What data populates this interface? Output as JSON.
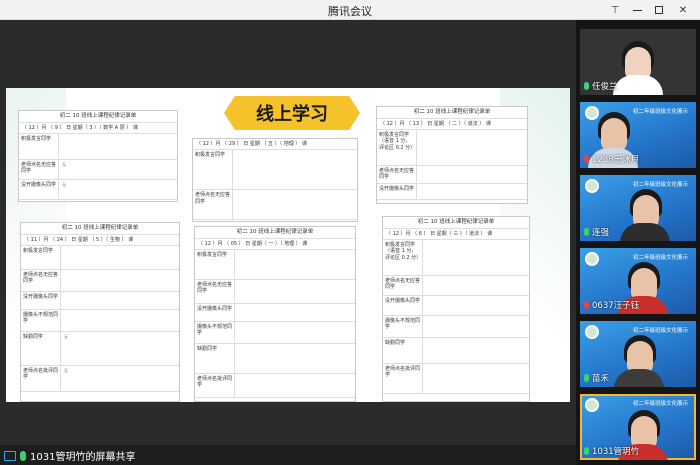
{
  "window": {
    "title": "腾讯会议"
  },
  "banner": "线上学习",
  "forms": [
    {
      "title": "初二 10 班线上课程纪律记录单",
      "head": "（ 12 ）月 （ 9 ） 日 星期（ 3 ）（ 数学 A 层 ） 课",
      "rows": [
        {
          "label": "积极发言同学",
          "value": ""
        },
        {
          "label": "老师点名无应答同学",
          "value": "无"
        },
        {
          "label": "没开摄像头同学",
          "value": "无"
        }
      ]
    },
    {
      "title": "初二 10 班线上课程纪律记录单",
      "head": "（ 11 ）月 （ 24 ） 日 星期 （ 5 ）（ 生物 ） 课",
      "rows": [
        {
          "label": "积极发言同学",
          "value": ""
        },
        {
          "label": "老师点名无应答同学",
          "value": ""
        },
        {
          "label": "没开摄像头同学",
          "value": ""
        },
        {
          "label": "摄像头不规范同学",
          "value": ""
        },
        {
          "label": "缺勤同学",
          "value": "无"
        },
        {
          "label": "老师点名批评同学",
          "value": "无"
        }
      ]
    },
    {
      "title": "",
      "head": "（ 12 ）月 （ 29 ） 日 星期 （ 五 ）（ 地理 ） 课",
      "rows": [
        {
          "label": "积极发言同学",
          "value": ""
        },
        {
          "label": "老师点名无应答同学",
          "value": ""
        }
      ]
    },
    {
      "title": "初二 10 班线上课程纪律记录单",
      "head": "（ 12 ）月 （ 05 ） 日 星期（ 一 ）（ 地理 ） 课",
      "rows": [
        {
          "label": "积极发言同学",
          "value": ""
        },
        {
          "label": "老师点名无应答同学",
          "value": ""
        },
        {
          "label": "没开摄像头同学",
          "value": ""
        },
        {
          "label": "摄像头不规范同学",
          "value": ""
        },
        {
          "label": "缺勤同学",
          "value": ""
        },
        {
          "label": "老师点名批评同学",
          "value": ""
        }
      ]
    },
    {
      "title": "初二 10 班线上课程纪律记录单",
      "head": "（ 12 ）月 （ 13 ） 日 星期 （ 二 ）（ 道法 ） 课",
      "rows": [
        {
          "label": "积极发言同学（语音 1 分，评论区 0.2 分）",
          "value": ""
        },
        {
          "label": "老师点名无应答同学",
          "value": ""
        },
        {
          "label": "没开摄像头同学",
          "value": ""
        }
      ]
    },
    {
      "title": "初二 10 班线上课程纪律记录单",
      "head": "（ 12 ）月 （ 6 ） 日 星期（ 三 ）（ 道法 ） 课",
      "rows": [
        {
          "label": "积极发言同学（语音 1 分，评论区 0.2 分）",
          "value": ""
        },
        {
          "label": "老师点名无应答同学",
          "value": ""
        },
        {
          "label": "没开摄像头同学",
          "value": ""
        },
        {
          "label": "摄像头不规范同学",
          "value": ""
        },
        {
          "label": "缺勤同学",
          "value": ""
        },
        {
          "label": "老师点名批评同学",
          "value": ""
        }
      ]
    }
  ],
  "sharer": {
    "label": "1031管玥竹的屏幕共享"
  },
  "participants": [
    {
      "name": "任俊兰",
      "caption": "",
      "mic": "on"
    },
    {
      "name": "1238王沐月",
      "caption": "初二年级班级文化展示",
      "mic": "off"
    },
    {
      "name": "连强",
      "caption": "初二年级班级文化展示",
      "mic": "on"
    },
    {
      "name": "0637汪子钰",
      "caption": "初二年级班级文化展示",
      "mic": "off"
    },
    {
      "name": "苗禾",
      "caption": "初二年级班级文化展示",
      "mic": "on"
    },
    {
      "name": "1031管玥竹",
      "caption": "初二年级班级文化展示",
      "mic": "on"
    }
  ]
}
